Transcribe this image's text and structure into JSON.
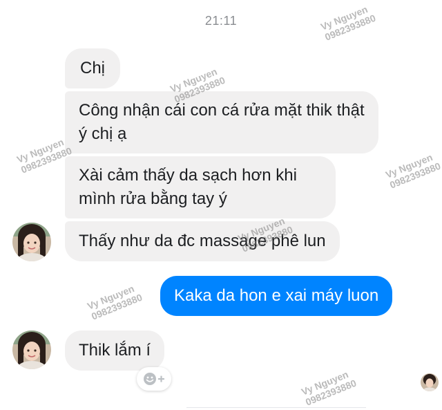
{
  "header": {
    "timestamp": "21:11"
  },
  "messages": [
    {
      "sender": "other",
      "text": "Chị"
    },
    {
      "sender": "other",
      "text": "Công nhận cái con cá rửa mặt thik thật ý chị ạ"
    },
    {
      "sender": "other",
      "text": "Xài cảm thấy da sạch hơn khi mình rửa bằng tay ý"
    },
    {
      "sender": "other",
      "text": "Thấy như da đc massage phê lun"
    },
    {
      "sender": "me",
      "text": "Kaka da hon e xai máy luon"
    },
    {
      "sender": "other",
      "text": "Thik lắm í"
    }
  ],
  "reaction_button": {
    "icon": "smiley-plus-icon"
  },
  "watermark": {
    "name": "Vy Nguyen",
    "phone": "0982393880"
  },
  "colors": {
    "incoming_bubble": "#f1f0f0",
    "outgoing_bubble": "#0084ff",
    "timestamp_text": "#8a8d91"
  }
}
